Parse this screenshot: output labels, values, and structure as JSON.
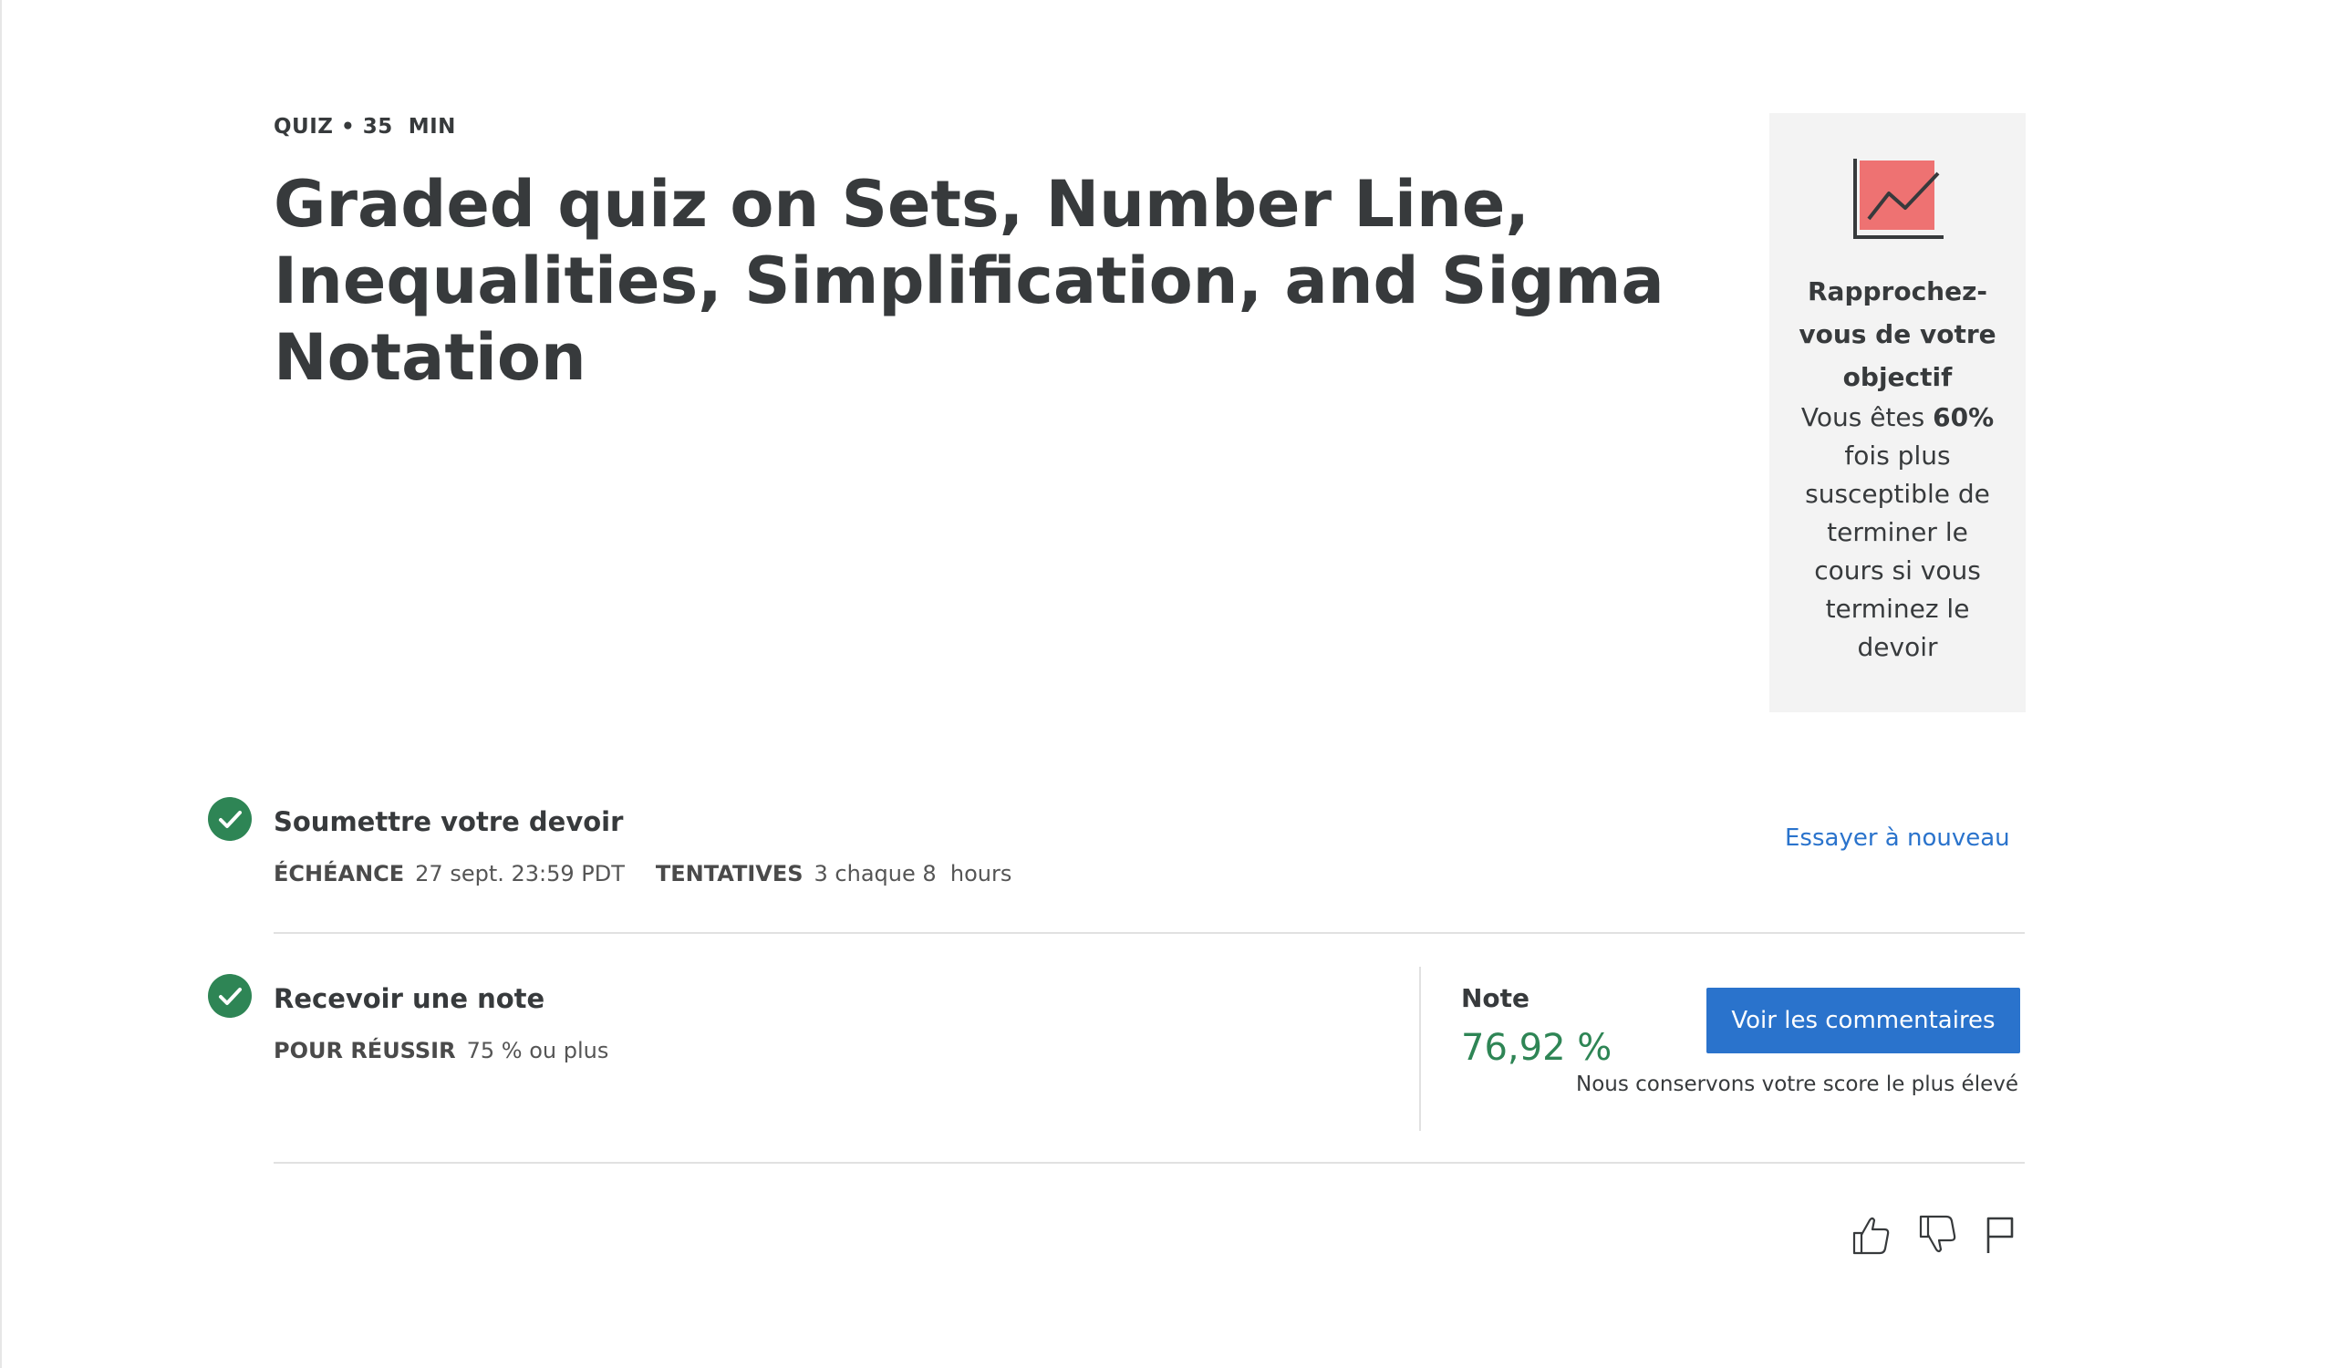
{
  "header": {
    "type": "QUIZ",
    "separator": "•",
    "duration": "35  MIN",
    "title": "Graded quiz on Sets, Number Line, Inequalities, Simplification, and Sigma Notation"
  },
  "goal_card": {
    "icon": "trend-chart-icon",
    "heading": "Rapprochez-vous de votre objectif",
    "text_before": "Vous êtes ",
    "highlight": "60%",
    "text_after": " fois plus susceptible de terminer le cours si vous terminez le devoir"
  },
  "submit_step": {
    "title": "Soumettre votre devoir",
    "due_label": "ÉCHÉANCE",
    "due_value": "27 sept. 23:59 PDT",
    "attempts_label": "TENTATIVES",
    "attempts_value": "3 chaque 8  hours",
    "retry_link": "Essayer à nouveau"
  },
  "grade_step": {
    "title": "Recevoir une note",
    "pass_label": "POUR RÉUSSIR",
    "pass_value": "75 % ou plus",
    "grade_label": "Note",
    "grade_value": "76,92 %",
    "feedback_button": "Voir les commentaires",
    "keep_note": "Nous conservons votre score le plus élevé"
  },
  "feedback_icons": [
    "thumbs-up-icon",
    "thumbs-down-icon",
    "flag-icon"
  ],
  "colors": {
    "accent_blue": "#2a73cc",
    "success_green": "#2e8555",
    "card_bg": "#f3f3f3",
    "chart_red": "#ee7272",
    "text": "#373a3c"
  }
}
